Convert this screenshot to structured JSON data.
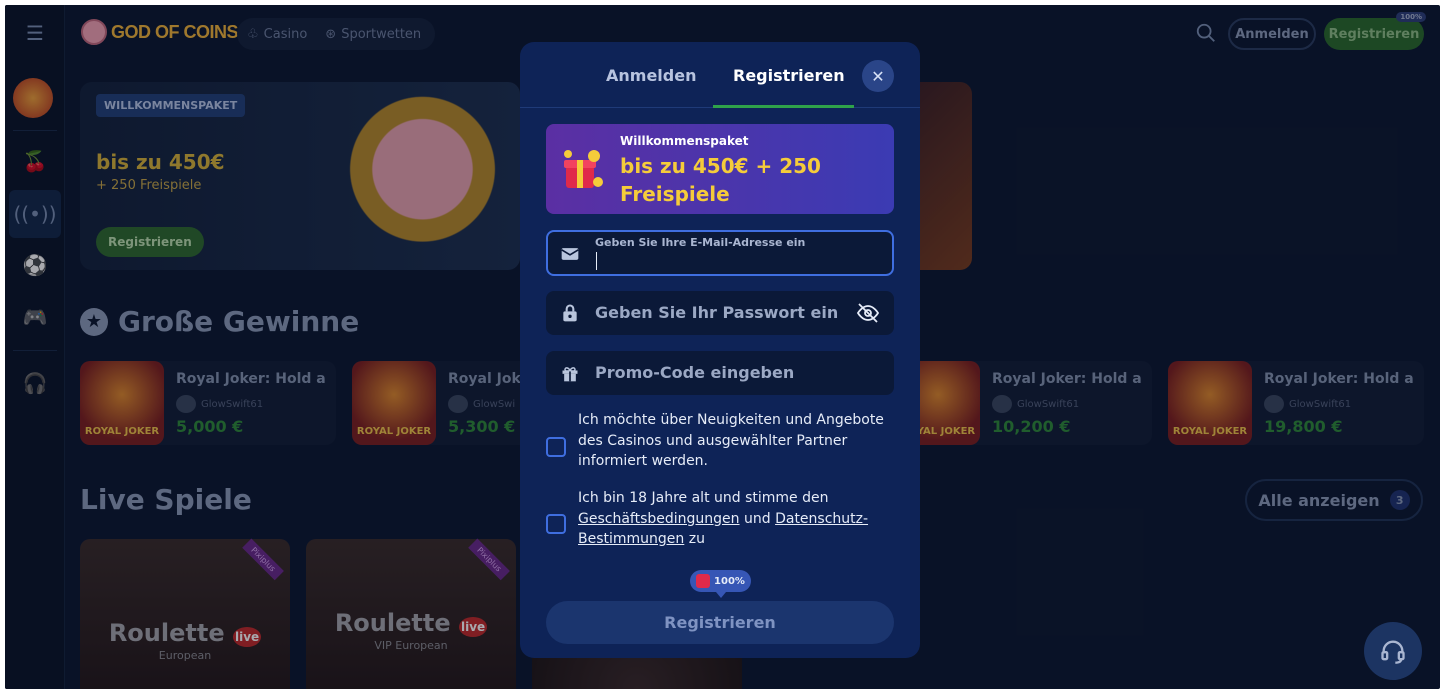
{
  "header": {
    "logo_text": "GOD OF COINS",
    "nav": [
      "Casino",
      "Sportwetten"
    ],
    "login_label": "Anmelden",
    "register_label": "Registrieren",
    "register_badge": "100%"
  },
  "banner": {
    "badge": "WILLKOMMENSPAKET",
    "headline": "bis zu 450€",
    "sub": "+ 250 Freispiele",
    "button": "Registrieren"
  },
  "big_wins": {
    "title": "Große Gewinne",
    "items": [
      {
        "game": "Royal Joker: Hold and",
        "user": "GlowSwift61",
        "amount": "5,000 €"
      },
      {
        "game": "Royal Joke",
        "user": "GlowSwi",
        "amount": "5,300 €"
      },
      {
        "game": "Royal Joker: Hold and",
        "user": "GlowSwift61",
        "amount": "10,200 €"
      },
      {
        "game": "Royal Joker: Hold and",
        "user": "GlowSwift61",
        "amount": "19,800 €"
      }
    ],
    "thumb_text": "ROYAL JOKER"
  },
  "live": {
    "title": "Live Spiele",
    "show_all": "Alle anzeigen",
    "count": "3",
    "games": [
      {
        "name": "Roulette",
        "sub": "European",
        "tag": "live",
        "ribbon": "Pixiplus"
      },
      {
        "name": "Roulette",
        "sub": "VIP European",
        "tag": "live",
        "ribbon": "Pixiplus"
      }
    ]
  },
  "modal": {
    "tab_login": "Anmelden",
    "tab_register": "Registrieren",
    "promo_title": "Willkommenspaket",
    "promo_value": "bis zu 450€ + 250 Freispiele",
    "email_label": "Geben Sie Ihre E-Mail-Adresse ein",
    "password_placeholder": "Geben Sie Ihr Passwort ein",
    "promo_placeholder": "Promo-Code eingeben",
    "news_consent": "Ich möchte über Neuigkeiten und Angebote des Casinos und ausgewählter Partner informiert werden.",
    "age_prefix": "Ich bin 18 Jahre alt und stimme den",
    "terms_link": "Geschäftsbedingungen",
    "and_word": "und",
    "privacy_link": "Datenschutz-Bestimmungen",
    "age_suffix": "zu",
    "bonus_tip": "100%",
    "submit": "Registrieren"
  },
  "colors": {
    "modal_bg": "#0e2357",
    "accent_green": "#2fa24a",
    "accent_blue": "#3f6ee0",
    "gold": "#f5cc3a"
  }
}
